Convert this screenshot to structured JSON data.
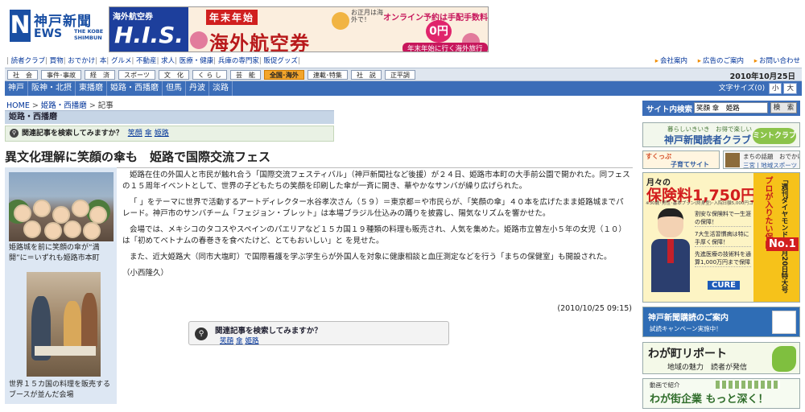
{
  "logo": {
    "mark": "N",
    "name_jp": "神戸新聞",
    "name_en": "EWS",
    "name_en_sub": "THE KOBE SHIMBUN"
  },
  "banner": {
    "his_tag": "海外航空券",
    "his_brand": "H.I.S.",
    "nenmatsu": "年末年始",
    "kaigai": "海外航空券",
    "mini": "お正月は海外で！",
    "online": "オンライン予約は手配手数料が",
    "zero": "0円",
    "cta": "年末年始に行く海外旅行"
  },
  "util": {
    "left_items": [
      "読者クラブ",
      "買物",
      "おでかけ",
      "本",
      "グルメ",
      "不動産",
      "求人",
      "医療・健康",
      "兵庫の専門家",
      "販促グッズ"
    ],
    "right_items": [
      "会社案内",
      "広告のご案内",
      "お問い合わせ"
    ]
  },
  "categories": [
    {
      "label": "社　会"
    },
    {
      "label": "事件･事故"
    },
    {
      "label": "経　済"
    },
    {
      "label": "スポーツ"
    },
    {
      "label": "文　化"
    },
    {
      "label": "く ら し"
    },
    {
      "label": "芸　能"
    },
    {
      "label": "全国･海外"
    },
    {
      "label": "連載･特集"
    },
    {
      "label": "社　説"
    },
    {
      "label": "正平調"
    }
  ],
  "date": "2010年10月25日",
  "regions": [
    "神戸",
    "阪神・北摂",
    "東播磨",
    "姫路・西播磨",
    "但馬",
    "丹波",
    "淡路"
  ],
  "fontsize": {
    "label": "文字サイズ(0)",
    "small": "小",
    "large": "大"
  },
  "breadcrumb": {
    "home": "HOME",
    "section": "姫路・西播磨",
    "current": "記事"
  },
  "section_title": "姫路・西播磨",
  "related": {
    "question": "関連記事を検索してみますか？",
    "tags": [
      "笑顔",
      "傘",
      "姫路"
    ]
  },
  "headline": "異文化理解に笑顔の傘も　姫路で国際交流フェス",
  "photos": {
    "caption1": "姫路城を前に笑顔の傘が“満開”に＝いずれも姫路市本町",
    "caption2": "世界１５カ国の料理を販売するブースが並んだ会場"
  },
  "article": {
    "paragraphs": [
      "姫路在住の外国人と市民が触れ合う「国際交流フェスティバル」（神戸新聞社など後援）が２４日、姫路市本町の大手前公園で開かれた。同フェスの１５周年イベントとして、世界の子どもたちの笑顔を印刷した傘が一斉に開き、華やかなサンバが繰り広げられた。",
      "「 」をテーマに世界で活動するアートディレクター水谷孝次さん（５９）＝東京都＝や市民らが、「笑顔の傘」４０本を広げたまま姫路城までパレード。神戸市のサンバチーム「フェジョン・ブレット」は本場ブラジル仕込みの踊りを披露し、陽気なリズムを響かせた。",
      "会場では、メキシコのタコスやスペインのパエリアなど１５カ国１９種類の料理も販売され、人気を集めた。姫路市立曽左小５年の女児（１０）は「初めてベトナムの春巻きを食べたけど、とてもおいしい」と を見せた。",
      "また、近大姫路大（同市大塩町）で国際看護を学ぶ学生らが外国人を対象に健康相談と血圧測定などを行う「まちの保健室」も開設された。"
    ],
    "byline": "（小西隆久）",
    "timestamp": "(2010/10/25 09:15)"
  },
  "sidebar": {
    "search_label": "サイト内検索",
    "search_value": "笑顔 傘　姫路",
    "search_button": "検　索",
    "club_top": "暮らしいきいき　お得で楽しい",
    "club_name": "神戸新聞読者クラブ",
    "club_badge": "ミントクラブ",
    "kids1": "すくっぷ",
    "kids2": "子育てサイト",
    "spot1": "まちの話題　おでかけ",
    "spot2": "三宮 | 地域スポーツ",
    "ad_price1": "月々の",
    "ad_price2": "保険料1,750円",
    "ad_fine": "※30歳･男性･基本プラン(終身型)･入院日額5,000円コースの場合",
    "ad_points": [
      "割安な保険料で一生涯の保障！",
      "7大生活習慣病は特に手厚く保障！",
      "先進医療の技術料を通算1,000万円まで保障"
    ],
    "ad_brand": "CURE",
    "ad_vert1": "プロが入りたい保険",
    "ad_vert2": "「週刊ダイヤモンド」3月20日特大号",
    "ad_no1": "No.1",
    "subscribe_title": "神戸新聞購読のご案内",
    "subscribe_sub": "試読キャンペーン実施中！",
    "town_title": "わが町リポート",
    "town_sub": "地域の魅力　読者が発信",
    "company_top": "動画で紹介",
    "company_title": "わが街企業 もっと深く！"
  }
}
